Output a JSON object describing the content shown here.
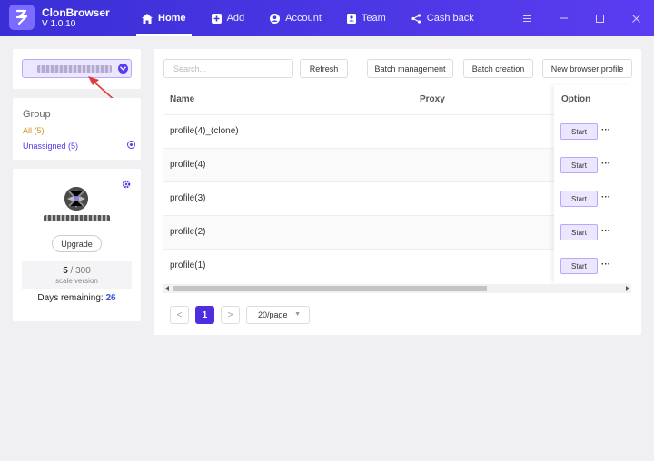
{
  "app": {
    "name": "ClonBrowser",
    "version": "V 1.0.10",
    "accent_color": "#4f2ee0"
  },
  "nav": [
    {
      "label": "Home",
      "icon": "home-icon",
      "active": true
    },
    {
      "label": "Add",
      "icon": "plus-square-icon",
      "active": false
    },
    {
      "label": "Account",
      "icon": "user-circle-icon",
      "active": false
    },
    {
      "label": "Team",
      "icon": "contact-card-icon",
      "active": false
    },
    {
      "label": "Cash back",
      "icon": "share-icon",
      "active": false
    }
  ],
  "window_controls": [
    "menu-icon",
    "minimize-icon",
    "maximize-icon",
    "close-icon"
  ],
  "groups": {
    "title": "Group",
    "all": "All  (5)",
    "unassigned": "Unassigned  (5)"
  },
  "account": {
    "upgrade_label": "Upgrade",
    "used": "5",
    "total": " / 300",
    "version_label": "scale version",
    "days_label": "Days remaining: ",
    "days_value": "26"
  },
  "toolbar": {
    "search_placeholder": "Search...",
    "refresh": "Refresh",
    "batch_management": "Batch management",
    "batch_creation": "Batch creation",
    "new_profile": "New browser profile"
  },
  "table": {
    "headers": {
      "name": "Name",
      "proxy": "Proxy",
      "option": "Option"
    },
    "rows": [
      {
        "name": "profile(4)_(clone)",
        "action": "Start",
        "more": "···"
      },
      {
        "name": "profile(4)",
        "action": "Start",
        "more": "···"
      },
      {
        "name": "profile(3)",
        "action": "Start",
        "more": "···"
      },
      {
        "name": "profile(2)",
        "action": "Start",
        "more": "···"
      },
      {
        "name": "profile(1)",
        "action": "Start",
        "more": "···"
      }
    ]
  },
  "pagination": {
    "prev": "<",
    "current": "1",
    "next": ">",
    "page_size": "20/page"
  }
}
